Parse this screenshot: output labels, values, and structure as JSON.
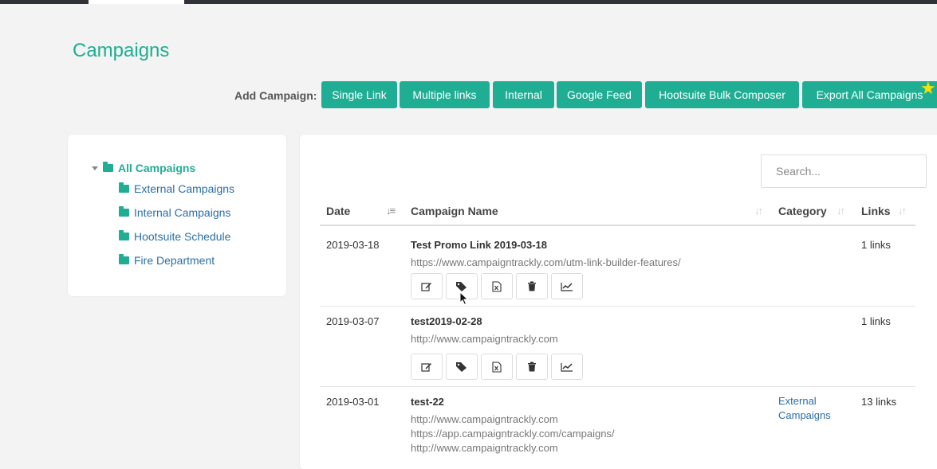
{
  "page": {
    "title": "Campaigns"
  },
  "add_campaign": {
    "label": "Add Campaign:",
    "buttons": [
      "Single Link",
      "Multiple links",
      "Internal",
      "Google Feed",
      "Hootsuite Bulk Composer",
      "Export All Campaigns"
    ]
  },
  "tree": {
    "root": "All Campaigns",
    "items": [
      "External Campaigns",
      "Internal Campaigns",
      "Hootsuite Schedule",
      "Fire Department"
    ]
  },
  "search": {
    "placeholder": "Search..."
  },
  "table": {
    "headers": {
      "date": "Date",
      "name": "Campaign Name",
      "category": "Category",
      "links": "Links"
    },
    "rows": [
      {
        "date": "2019-03-18",
        "name": "Test Promo Link 2019-03-18",
        "urls": [
          "https://www.campaigntrackly.com/utm-link-builder-features/"
        ],
        "category": "",
        "links": "1 links"
      },
      {
        "date": "2019-03-07",
        "name": "test2019-02-28",
        "urls": [
          "http://www.campaigntrackly.com"
        ],
        "category": "",
        "links": "1 links"
      },
      {
        "date": "2019-03-01",
        "name": "test-22",
        "urls": [
          "http://www.campaigntrackly.com",
          "https://app.campaigntrackly.com/campaigns/",
          "http://www.campaigntrackly.com"
        ],
        "category": "External Campaigns",
        "links": "13 links"
      }
    ]
  },
  "icons": {
    "actions": [
      "edit-icon",
      "tags-icon",
      "excel-icon",
      "trash-icon",
      "chart-icon"
    ]
  },
  "colors": {
    "accent": "#1fae94",
    "link": "#2a6fa8",
    "star": "#f5e400"
  }
}
